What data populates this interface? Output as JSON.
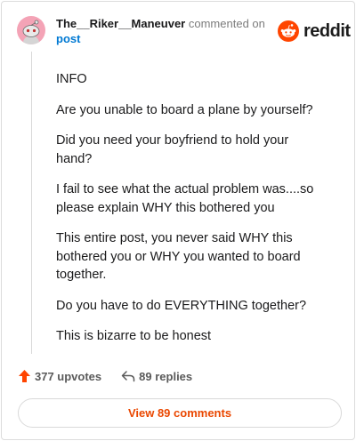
{
  "comment": {
    "username": "The__Riker__Maneuver",
    "action": "commented on",
    "post_link": "post",
    "brand": "reddit",
    "paragraphs": [
      "INFO",
      "Are you unable to board a plane by yourself?",
      "Did you need your boyfriend to hold your hand?",
      "I fail to see what the actual problem was....so please explain WHY this bothered you",
      "This entire post, you never said WHY this bothered you or WHY you wanted to board together.",
      "Do you have to do EVERYTHING together?",
      "This is bizarre to be honest"
    ]
  },
  "footer": {
    "upvotes": "377 upvotes",
    "replies": "89 replies",
    "view_comments": "View 89 comments"
  },
  "colors": {
    "accent": "#ea4700",
    "upvote": "#ff4500",
    "link": "#0079d3",
    "avatar_bg": "#f4a3b6"
  },
  "icons": {
    "avatar": "snoo-avatar-icon",
    "brand": "reddit-snoo-icon",
    "upvote": "upvote-arrow-icon",
    "reply": "reply-arrow-icon"
  }
}
